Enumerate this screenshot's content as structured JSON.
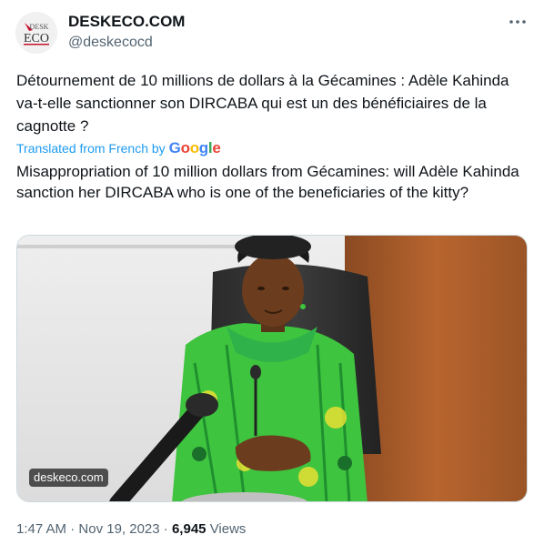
{
  "author": {
    "display_name": "DESKECO.COM",
    "handle": "@deskecocd",
    "avatar_text_top": "DESK",
    "avatar_text_bottom": "ECO"
  },
  "tweet": {
    "text_original": "Détournement de 10 millions de dollars à la Gécamines : Adèle Kahinda va-t-elle sanctionner son DIRCABA qui est un des bénéficiaires de la cagnotte ?",
    "translated_label": "Translated from French by",
    "translator_brand": "Google",
    "text_translated": "Misappropriation of 10 million dollars from Gécamines: will Adèle Kahinda sanction her DIRCABA who is one of the beneficiaries of the kitty?"
  },
  "media": {
    "watermark": "deskeco.com"
  },
  "meta": {
    "time": "1:47 AM",
    "separator": "·",
    "date": "Nov 19, 2023",
    "views_count": "6,945",
    "views_label": "Views"
  },
  "colors": {
    "accent": "#1d9bf0",
    "secondary_text": "#536471",
    "dress_green": "#3cc23c"
  },
  "icons": {
    "more": "more-horizontal-icon"
  }
}
